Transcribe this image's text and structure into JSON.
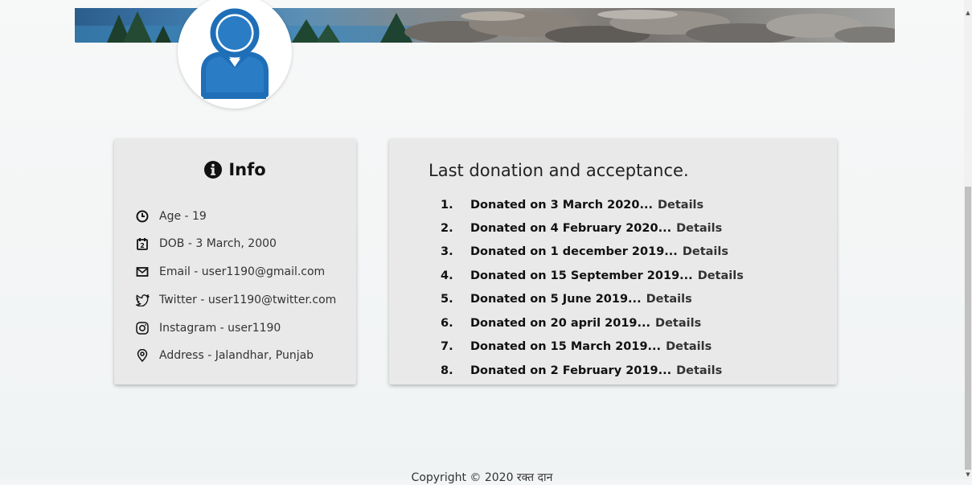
{
  "profile": {
    "banner_label": "cover-photo",
    "avatar_label": "user-avatar"
  },
  "info": {
    "title": "Info",
    "items": [
      {
        "icon": "clock-icon",
        "text": "Age - 19"
      },
      {
        "icon": "calendar-icon",
        "text": "DOB - 3 March, 2000"
      },
      {
        "icon": "mail-icon",
        "text": "Email - user1190@gmail.com"
      },
      {
        "icon": "twitter-icon",
        "text": "Twitter - user1190@twitter.com"
      },
      {
        "icon": "instagram-icon",
        "text": "Instagram - user1190"
      },
      {
        "icon": "location-pin-icon",
        "text": "Address - Jalandhar, Punjab"
      }
    ]
  },
  "donations": {
    "title": "Last donation and acceptance.",
    "details_label": "Details",
    "items": [
      {
        "num": "1.",
        "text": "Donated on 3 March 2020..."
      },
      {
        "num": "2.",
        "text": "Donated on 4 February 2020..."
      },
      {
        "num": "3.",
        "text": "Donated on 1 december 2019..."
      },
      {
        "num": "4.",
        "text": "Donated on 15 September 2019..."
      },
      {
        "num": "5.",
        "text": "Donated on 5 June 2019..."
      },
      {
        "num": "6.",
        "text": "Donated on 20 april 2019..."
      },
      {
        "num": "7.",
        "text": "Donated on 15 March 2019..."
      },
      {
        "num": "8.",
        "text": "Donated on 2 February 2019..."
      }
    ]
  },
  "footer": {
    "copyright": "Copyright © 2020 रक्त दान"
  },
  "colors": {
    "card_bg": "#e9e9e9",
    "avatar_blue": "#1f6fb8",
    "page_bg": "#f3f5f6"
  }
}
